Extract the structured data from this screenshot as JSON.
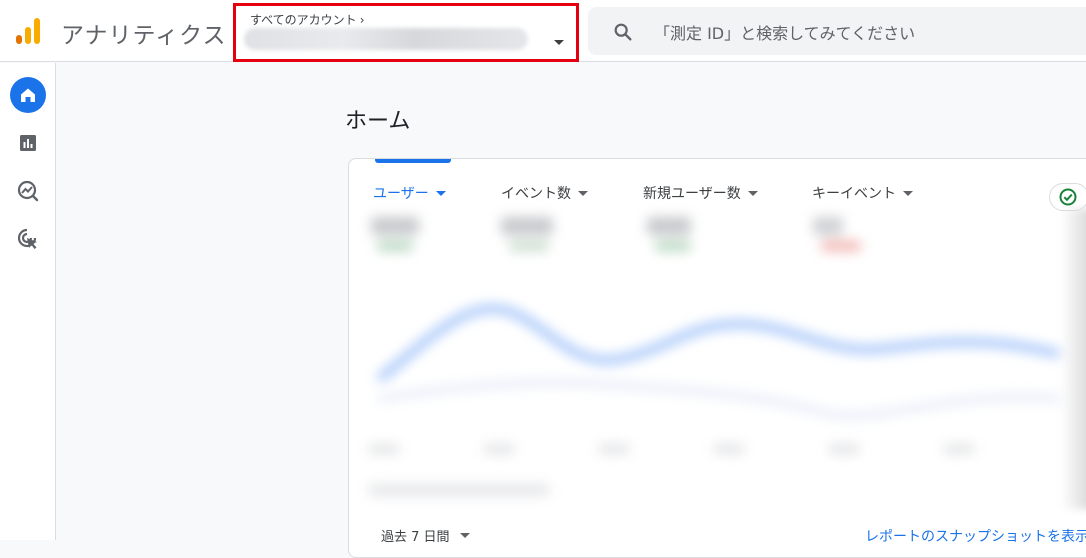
{
  "app": {
    "title": "アナリティクス",
    "logo_colors": [
      "#f9ab00",
      "#e37400"
    ]
  },
  "account": {
    "breadcrumb": "すべてのアカウント",
    "breadcrumb_icon": "chevron-right-icon",
    "selected_value": ""
  },
  "search": {
    "placeholder": "「測定 ID」と検索してみてください",
    "icon": "search-icon"
  },
  "sidebar": {
    "items": [
      {
        "icon": "home-icon",
        "active": true
      },
      {
        "icon": "reports-icon",
        "active": false
      },
      {
        "icon": "explore-icon",
        "active": false
      },
      {
        "icon": "advertising-icon",
        "active": false
      }
    ]
  },
  "page": {
    "title": "ホーム"
  },
  "card": {
    "tabs": [
      {
        "label": "ユーザー",
        "active": true
      },
      {
        "label": "イベント数",
        "active": false
      },
      {
        "label": "新規ユーザー数",
        "active": false
      },
      {
        "label": "キーイベント",
        "active": false
      }
    ],
    "status_icon": "check-circle-icon",
    "date_range": "過去 7 日間",
    "snapshot_link": "レポートのスナップショットを表示"
  },
  "colors": {
    "accent": "#1a73e8",
    "highlight_box": "#e4000f"
  }
}
